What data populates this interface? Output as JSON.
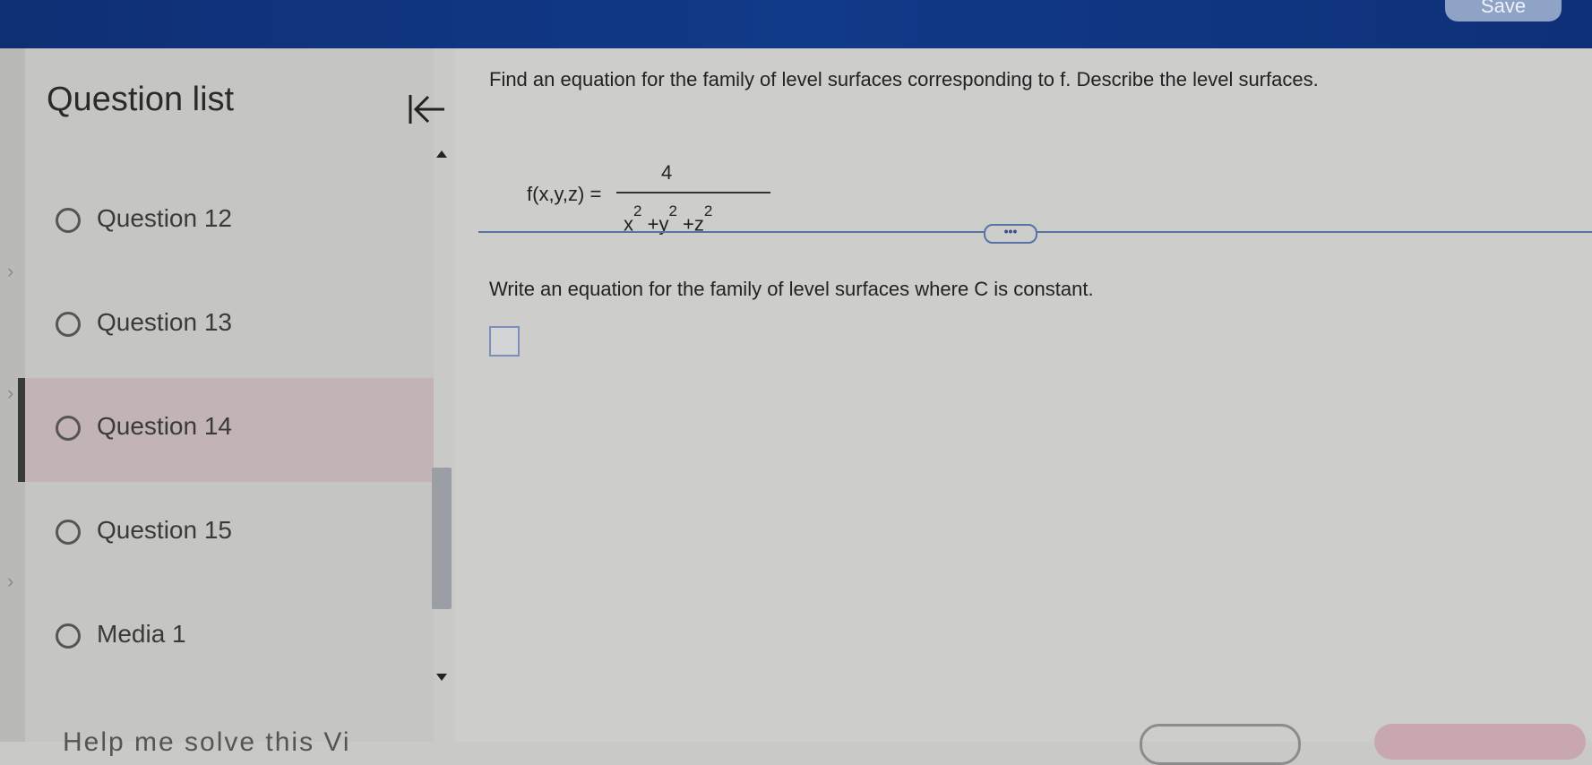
{
  "topbar": {
    "save_label": "Save"
  },
  "sidebar": {
    "title": "Question list",
    "items": [
      {
        "label": "Question 12",
        "selected": false
      },
      {
        "label": "Question 13",
        "selected": false
      },
      {
        "label": "Question 14",
        "selected": true
      },
      {
        "label": "Question 15",
        "selected": false
      },
      {
        "label": "Media 1",
        "selected": false
      }
    ]
  },
  "question": {
    "prompt": "Find an equation for the family of level surfaces corresponding to f. Describe the level surfaces.",
    "formula": {
      "lhs": "f(x,y,z) =",
      "numerator": "4",
      "denominator": {
        "x": "x",
        "y": "y",
        "z": "z",
        "exp": "2",
        "plus": "+"
      }
    },
    "more_label": "•••",
    "instruction": "Write an equation for the family of level surfaces where C is constant."
  },
  "bottom": {
    "help_text": "Help me solve this   Vi"
  },
  "colors": {
    "topbar": "#113a8a",
    "selected_item": "#c2b4b4",
    "accent": "#5872a8"
  }
}
